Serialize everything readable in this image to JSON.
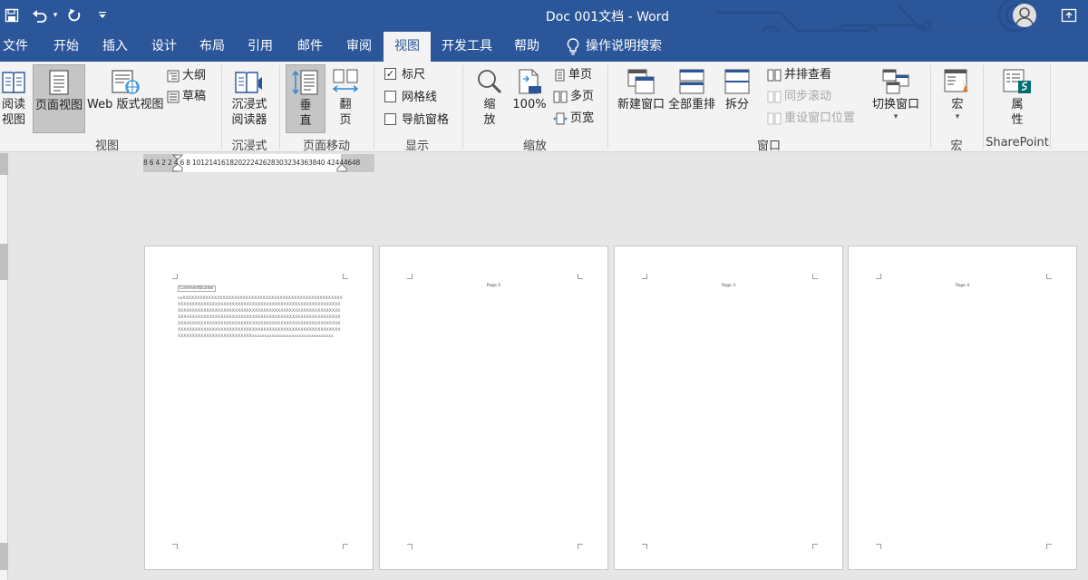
{
  "title": "Doc 001文档  -  Word",
  "quick_access": {
    "save_icon": "save-icon",
    "undo_icon": "undo-icon",
    "redo_icon": "redo-icon",
    "customize_icon": "customize-quick-access-icon"
  },
  "tabs": {
    "file": "文件",
    "home": "开始",
    "insert": "插入",
    "design": "设计",
    "layout": "布局",
    "references": "引用",
    "mailings": "邮件",
    "review": "审阅",
    "view": "视图",
    "developer": "开发工具",
    "help": "帮助",
    "tell_me": "操作说明搜索"
  },
  "active_tab": "view",
  "ribbon": {
    "views": {
      "read_mode": "阅读\n视图",
      "print_layout": "页面视图",
      "web_layout": "Web 版式视图",
      "outline": "大纲",
      "draft": "草稿",
      "label": "视图"
    },
    "immersive": {
      "immersive_reader": "沉浸式\n阅读器",
      "label": "沉浸式"
    },
    "page_movement": {
      "vertical": "垂\n直",
      "side_to_side": "翻\n页",
      "label": "页面移动"
    },
    "show": {
      "ruler": "标尺",
      "ruler_checked": true,
      "gridlines": "网格线",
      "gridlines_checked": false,
      "nav_pane": "导航窗格",
      "nav_pane_checked": false,
      "label": "显示"
    },
    "zoom": {
      "zoom": "缩\n放",
      "hundred": "100%",
      "one_page": "单页",
      "multiple_pages": "多页",
      "page_width": "页宽",
      "label": "缩放"
    },
    "window": {
      "new_window": "新建窗口",
      "arrange_all": "全部重排",
      "split": "拆分",
      "side_by_side": "并排查看",
      "sync_scroll": "同步滚动",
      "reset_position": "重设窗口位置",
      "switch_windows": "切换窗口",
      "label": "窗口"
    },
    "macros": {
      "macros": "宏",
      "label": "宏"
    },
    "sharepoint": {
      "properties": "属\n性",
      "label": "SharePoint"
    }
  },
  "ruler": {
    "numbers": "8  6  4  2        2  4  6  8  10121416182022242628303234363840  42444648"
  },
  "pages": [
    {
      "header": "",
      "content_control": "CommentBuilder",
      "body": "xxXXXXXXXXXXXXXXXXXXXXXXXXXXXXXXXXXXXXXXXXXXXXXXXXXXXXXXXXXXXXXXXXXXXXXXXXXXXXXXXXXXXXXXXXXXXXXXXXXXXXXXXXXXXXXXXXXXXXXXXXXXXXXXXXXXXXXXXXXXXXXXXXXXXXXXXXXXXXXXXXXXXXXXXXXXXXXXXXXXXXXXXXXXXXXXXXXXXXXXXXXXXXXXXXXXXXXXXXXXXXXXXXXXXXXXXXXXXXXXXXXXXXXXXXXXXXXXXXXXXXXXXXXXXXXXXXXXXXXXXXXXXXXXXXXXXXXXXXXXXXXXXXXXXXXXXXXXXXXXXXXXXXXXXXXXXXXXXXXXXXXXXXXXXXXXXXXXXXXXXXXXXXXXXxxxxxxxxxxxxxxxxxxxxxxxxxxxxxxxxx"
    },
    {
      "header": "Page 2",
      "content_control": "",
      "body": ""
    },
    {
      "header": "Page 3",
      "content_control": "",
      "body": ""
    },
    {
      "header": "Page 4",
      "content_control": "",
      "body": ""
    }
  ],
  "colors": {
    "brand": "#2b579a",
    "ribbon_bg": "#f3f3f3",
    "canvas_bg": "#e6e6e6"
  }
}
